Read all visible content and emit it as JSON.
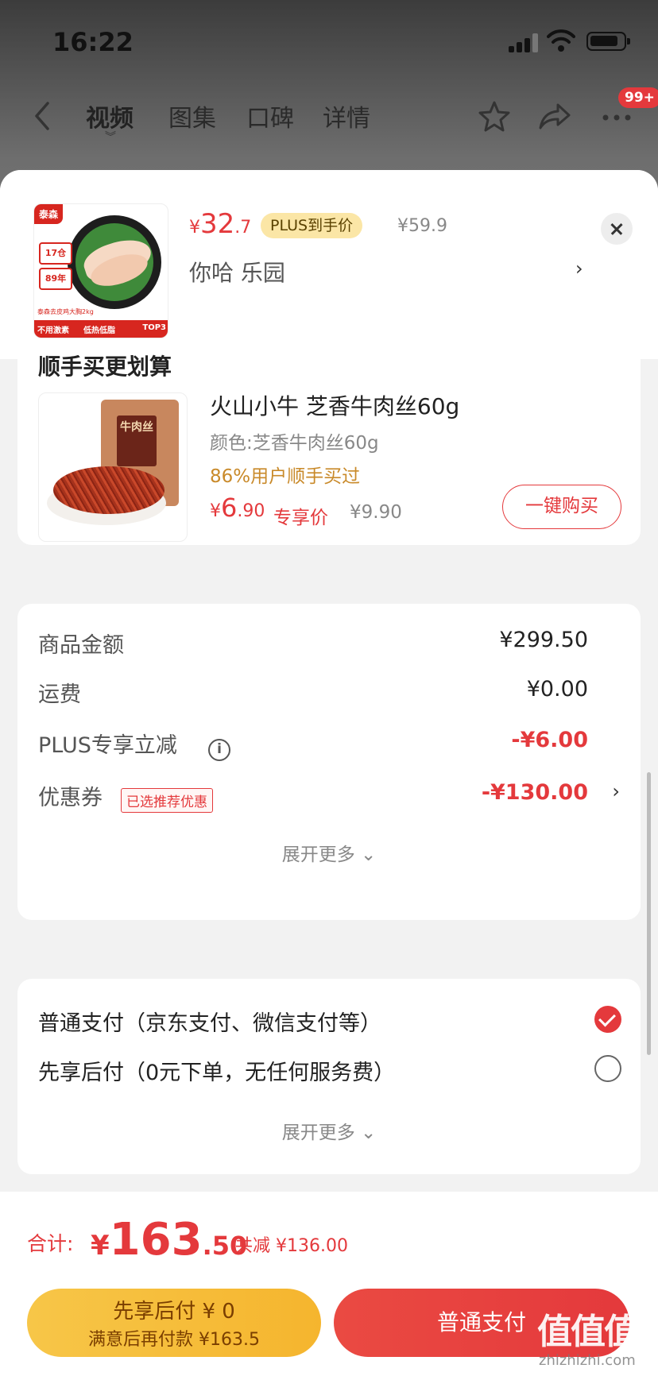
{
  "status_bar": {
    "time": "16:22"
  },
  "nav": {
    "tabs": [
      "视频",
      "图集",
      "口碑",
      "详情"
    ],
    "badge": "99+"
  },
  "product": {
    "thumb": {
      "brand": "泰森",
      "tag1": "17仓",
      "tag2": "89年",
      "caption": "泰森去皮鸡大胸2kg",
      "bottom_left": "不用激素",
      "bottom_mid": "低热低脂",
      "top3": "TOP3"
    },
    "price_currency": "¥",
    "price_int": "32",
    "price_dec": ".7",
    "plus_tag": "PLUS到手价",
    "original_price": "¥59.9",
    "spec": "你哈  乐园"
  },
  "addon": {
    "title": "顺手买更划算",
    "bag_label": "牛肉丝",
    "name": "火山小牛 芝香牛肉丝60g",
    "color": "颜色:芝香牛肉丝60g",
    "popular": "86%用户顺手买过",
    "price_currency": "¥",
    "price_int": "6",
    "price_dec": ".90",
    "price_label": "专享价",
    "original_price": "¥9.90",
    "buy_button": "一键购买"
  },
  "summary": {
    "goods_label": "商品金额",
    "goods_value": "¥299.50",
    "shipping_label": "运费",
    "shipping_value": "¥0.00",
    "plus_label": "PLUS专享立减",
    "plus_value": "-¥6.00",
    "coupon_label": "优惠券",
    "coupon_tag": "已选推荐优惠",
    "coupon_value": "-¥130.00",
    "expand": "展开更多"
  },
  "payment": {
    "option1": "普通支付（京东支付、微信支付等）",
    "option2": "先享后付（0元下单，无任何服务费）",
    "option1_selected": true,
    "expand": "展开更多"
  },
  "footer": {
    "total_label": "合计:",
    "total_currency": "¥",
    "total_int": "163",
    "total_dec": ".50",
    "saved": "共减 ¥136.00",
    "later_line1": "先享后付 ¥ 0",
    "later_line2": "满意后再付款 ¥163.5",
    "normal_pay": "普通支付"
  },
  "watermark": {
    "main": "值值值",
    "sub": "zhizhizhi.com"
  },
  "colors": {
    "accent": "#e4393c",
    "plus_tag_bg": "#fbe6a6",
    "later_button": "#f7c648",
    "popular_text": "#c98a2a"
  }
}
